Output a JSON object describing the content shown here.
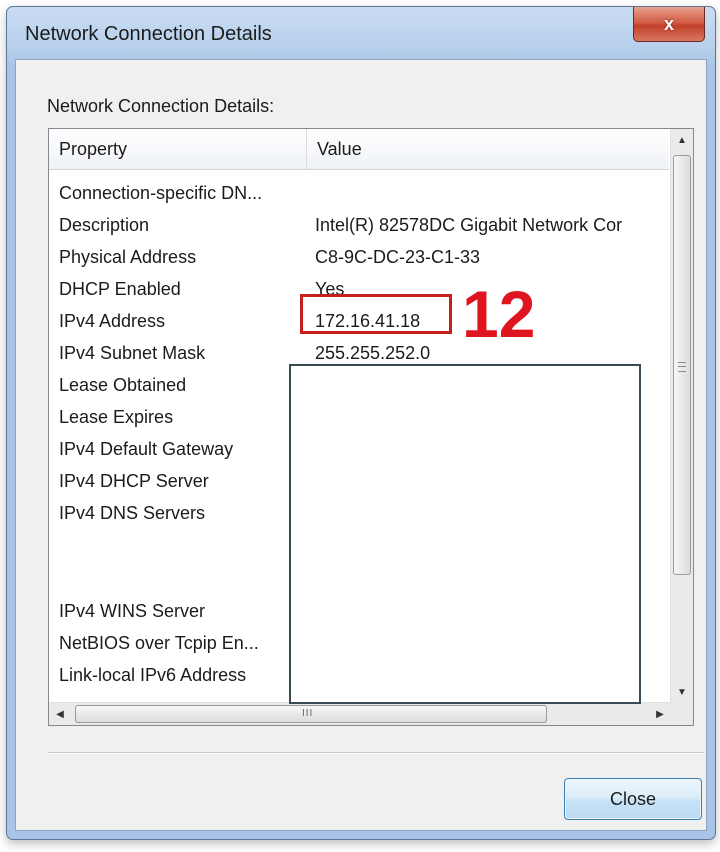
{
  "window": {
    "title": "Network Connection Details",
    "close_glyph": "x"
  },
  "group_label": "Network Connection Details:",
  "columns": {
    "property": "Property",
    "value": "Value"
  },
  "rows": [
    {
      "property": "Connection-specific DN...",
      "value": ""
    },
    {
      "property": "Description",
      "value": "Intel(R) 82578DC Gigabit Network Cor"
    },
    {
      "property": "Physical Address",
      "value": "C8-9C-DC-23-C1-33"
    },
    {
      "property": "DHCP Enabled",
      "value": "Yes"
    },
    {
      "property": "IPv4 Address",
      "value": "172.16.41.18"
    },
    {
      "property": "IPv4 Subnet Mask",
      "value": "255.255.252.0"
    },
    {
      "property": "Lease Obtained",
      "value": ""
    },
    {
      "property": "Lease Expires",
      "value": ""
    },
    {
      "property": "IPv4 Default Gateway",
      "value": ""
    },
    {
      "property": "IPv4 DHCP Server",
      "value": ""
    },
    {
      "property": "IPv4 DNS Servers",
      "value": ""
    },
    {
      "property": "",
      "value": ""
    },
    {
      "property": "",
      "value": ""
    },
    {
      "property": "IPv4 WINS Server",
      "value": ""
    },
    {
      "property": "NetBIOS over Tcpip En...",
      "value": ""
    },
    {
      "property": "Link-local IPv6 Address",
      "value": ""
    }
  ],
  "scrollbar": {
    "up": "▲",
    "down": "▼",
    "left": "◀",
    "right": "▶",
    "hgrip": "III"
  },
  "annotation": {
    "number": "12",
    "color": "#e0141e"
  },
  "buttons": {
    "close": "Close"
  }
}
